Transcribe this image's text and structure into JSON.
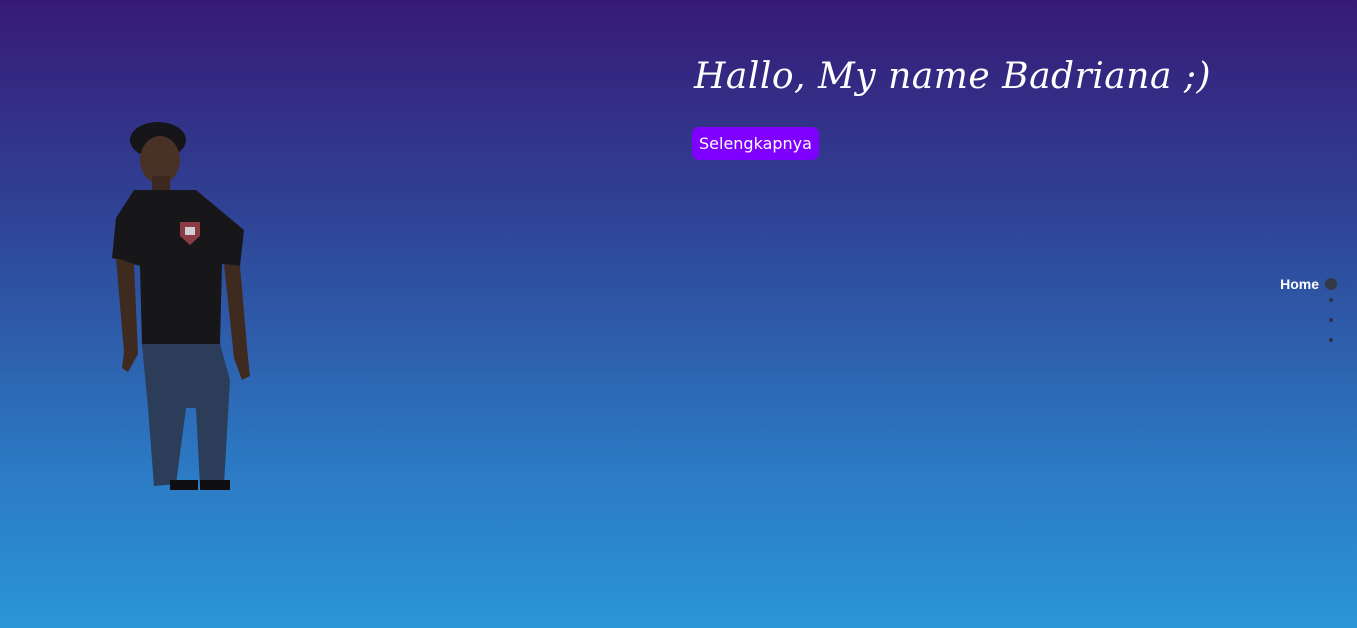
{
  "hero": {
    "greeting": "Hallo, My name Badriana ;)",
    "more_button_label": "Selengkapnya"
  },
  "side_nav": {
    "items": [
      {
        "label": "Home",
        "active": true
      },
      {
        "label": "",
        "active": false
      },
      {
        "label": "",
        "active": false
      },
      {
        "label": "",
        "active": false
      }
    ]
  },
  "colors": {
    "background_top": "#371a77",
    "background_bottom": "#2a96d6",
    "button": "#7f00ff",
    "text": "#ffffff"
  }
}
